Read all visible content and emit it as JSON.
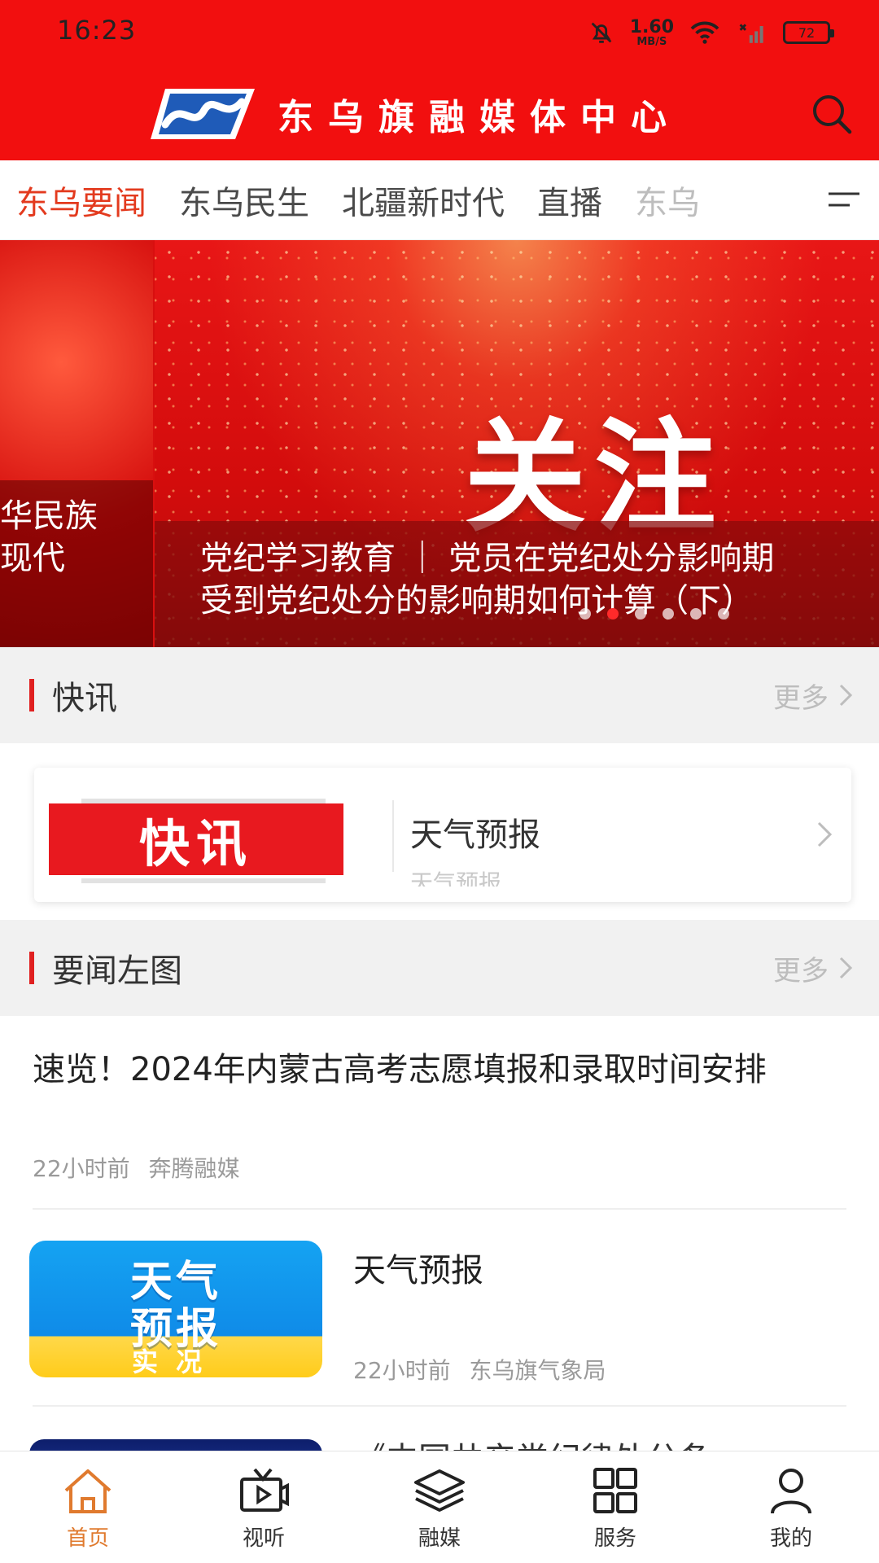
{
  "status_bar": {
    "time": "16:23",
    "net_speed_value": "1.60",
    "net_speed_unit": "MB/S",
    "battery": "72"
  },
  "header": {
    "title": "东乌旗融媒体中心",
    "colors": {
      "primary": "#f20f0f",
      "accent": "#e33a1e"
    }
  },
  "tabs": [
    {
      "label": "东乌要闻",
      "active": true
    },
    {
      "label": "东乌民生"
    },
    {
      "label": "北疆新时代"
    },
    {
      "label": "直播"
    },
    {
      "label": "东乌"
    }
  ],
  "banner": {
    "main_word": "关注",
    "prev_caption_line1": "华民族",
    "prev_caption_line2": "现代",
    "caption_line1": "党纪学习教育 ｜ 党员在党纪处分影响期",
    "caption_line2": "受到党纪处分的影响期如何计算（下）",
    "dots": 6,
    "active_dot": 1
  },
  "sections": {
    "flash": {
      "title": "快讯",
      "more": "更多"
    },
    "news": {
      "title": "要闻左图",
      "more": "更多"
    }
  },
  "flash_card": {
    "badge": "快讯",
    "title": "天气预报",
    "subtitle": "天气预报"
  },
  "news": [
    {
      "title": "速览！2024年内蒙古高考志愿填报和录取时间安排",
      "time": "22小时前",
      "source": "奔腾融媒"
    },
    {
      "title": "天气预报",
      "time": "22小时前",
      "source": "东乌旗气象局",
      "thumb_line1": "天气",
      "thumb_line2": "预报",
      "thumb_line3": "实况"
    },
    {
      "title": "《中国共产党纪律处分条"
    }
  ],
  "bottom_nav": [
    {
      "label": "首页",
      "icon": "home-icon",
      "active": true
    },
    {
      "label": "视听",
      "icon": "tv-icon"
    },
    {
      "label": "融媒",
      "icon": "layers-icon"
    },
    {
      "label": "服务",
      "icon": "grid-icon"
    },
    {
      "label": "我的",
      "icon": "user-icon"
    }
  ]
}
